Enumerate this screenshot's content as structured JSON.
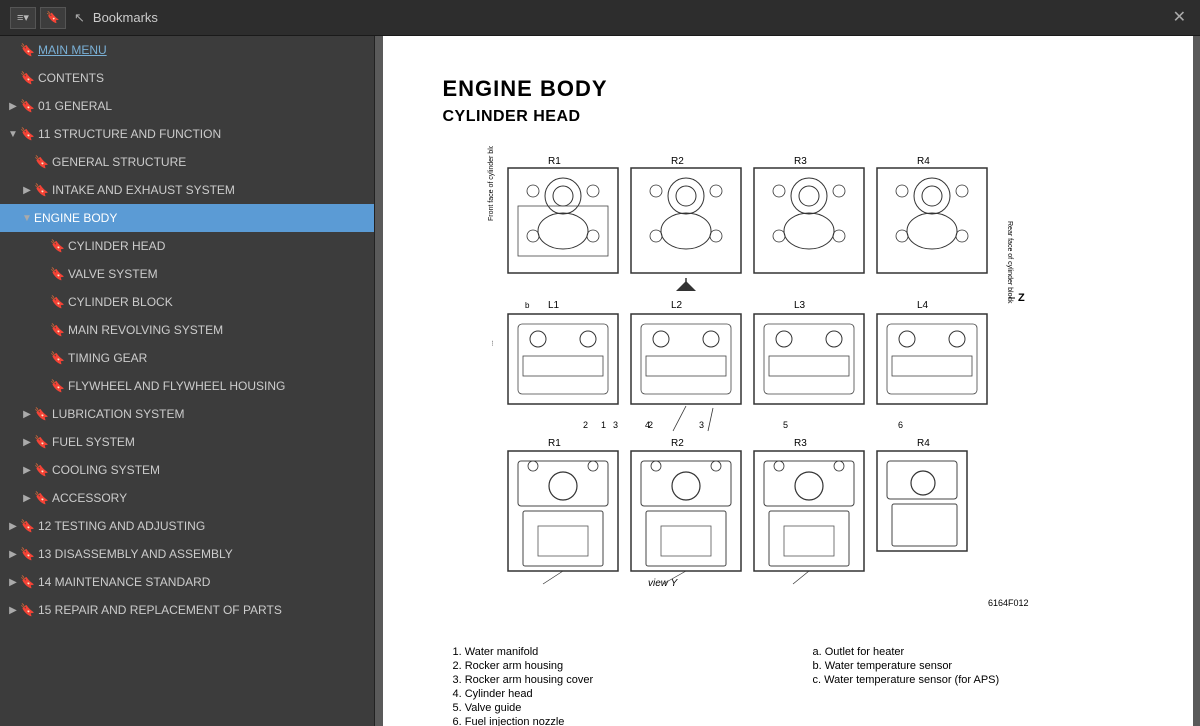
{
  "topbar": {
    "title": "Bookmarks",
    "close_label": "✕",
    "icon1": "≡▾",
    "icon2": "🔖"
  },
  "sidebar": {
    "items": [
      {
        "id": "main-menu",
        "label": "MAIN MENU",
        "indent": 0,
        "arrow": "",
        "bookmark": true,
        "link": true,
        "active": false
      },
      {
        "id": "contents",
        "label": "CONTENTS",
        "indent": 0,
        "arrow": "",
        "bookmark": true,
        "link": false,
        "active": false
      },
      {
        "id": "01-general",
        "label": "01 GENERAL",
        "indent": 0,
        "arrow": "▶",
        "bookmark": true,
        "link": false,
        "active": false
      },
      {
        "id": "11-structure",
        "label": "11 STRUCTURE AND FUNCTION",
        "indent": 0,
        "arrow": "▼",
        "bookmark": true,
        "link": false,
        "active": false
      },
      {
        "id": "general-structure",
        "label": "GENERAL STRUCTURE",
        "indent": 1,
        "arrow": "",
        "bookmark": true,
        "link": false,
        "active": false
      },
      {
        "id": "intake-exhaust",
        "label": "INTAKE AND EXHAUST SYSTEM",
        "indent": 1,
        "arrow": "▶",
        "bookmark": true,
        "link": false,
        "active": false
      },
      {
        "id": "engine-body",
        "label": "ENGINE BODY",
        "indent": 1,
        "arrow": "▼",
        "bookmark": false,
        "link": false,
        "active": true
      },
      {
        "id": "cylinder-head",
        "label": "CYLINDER HEAD",
        "indent": 2,
        "arrow": "",
        "bookmark": true,
        "link": false,
        "active": false
      },
      {
        "id": "valve-system",
        "label": "VALVE SYSTEM",
        "indent": 2,
        "arrow": "",
        "bookmark": true,
        "link": false,
        "active": false
      },
      {
        "id": "cylinder-block",
        "label": "CYLINDER BLOCK",
        "indent": 2,
        "arrow": "",
        "bookmark": true,
        "link": false,
        "active": false
      },
      {
        "id": "main-revolving",
        "label": "MAIN REVOLVING SYSTEM",
        "indent": 2,
        "arrow": "",
        "bookmark": true,
        "link": false,
        "active": false
      },
      {
        "id": "timing-gear",
        "label": "TIMING GEAR",
        "indent": 2,
        "arrow": "",
        "bookmark": true,
        "link": false,
        "active": false
      },
      {
        "id": "flywheel",
        "label": "FLYWHEEL AND FLYWHEEL HOUSING",
        "indent": 2,
        "arrow": "",
        "bookmark": true,
        "link": false,
        "active": false
      },
      {
        "id": "lubrication",
        "label": "LUBRICATION SYSTEM",
        "indent": 1,
        "arrow": "▶",
        "bookmark": true,
        "link": false,
        "active": false
      },
      {
        "id": "fuel-system",
        "label": "FUEL SYSTEM",
        "indent": 1,
        "arrow": "▶",
        "bookmark": true,
        "link": false,
        "active": false
      },
      {
        "id": "cooling-system",
        "label": "COOLING SYSTEM",
        "indent": 1,
        "arrow": "▶",
        "bookmark": true,
        "link": false,
        "active": false
      },
      {
        "id": "accessory",
        "label": "ACCESSORY",
        "indent": 1,
        "arrow": "▶",
        "bookmark": true,
        "link": false,
        "active": false
      },
      {
        "id": "12-testing",
        "label": "12 TESTING AND ADJUSTING",
        "indent": 0,
        "arrow": "▶",
        "bookmark": true,
        "link": false,
        "active": false
      },
      {
        "id": "13-disassembly",
        "label": "13 DISASSEMBLY AND ASSEMBLY",
        "indent": 0,
        "arrow": "▶",
        "bookmark": true,
        "link": false,
        "active": false
      },
      {
        "id": "14-maintenance",
        "label": "14 MAINTENANCE STANDARD",
        "indent": 0,
        "arrow": "▶",
        "bookmark": true,
        "link": false,
        "active": false
      },
      {
        "id": "15-repair",
        "label": "15 REPAIR AND REPLACEMENT OF PARTS",
        "indent": 0,
        "arrow": "▶",
        "bookmark": true,
        "link": false,
        "active": false
      }
    ]
  },
  "content": {
    "title": "ENGINE BODY",
    "subtitle": "CYLINDER HEAD",
    "figure_id": "6164F012",
    "view_label": "view Y",
    "legend": {
      "left": [
        "1.  Water manifold",
        "2.  Rocker arm housing",
        "3.  Rocker arm housing cover",
        "4.  Cylinder head",
        "5.  Valve guide",
        "6.  Fuel injection nozzle"
      ],
      "right": [
        "a.  Outlet for heater",
        "b.  Water temperature sensor",
        "c.  Water temperature sensor (for APS)"
      ]
    }
  },
  "collapse_arrow": "◀"
}
